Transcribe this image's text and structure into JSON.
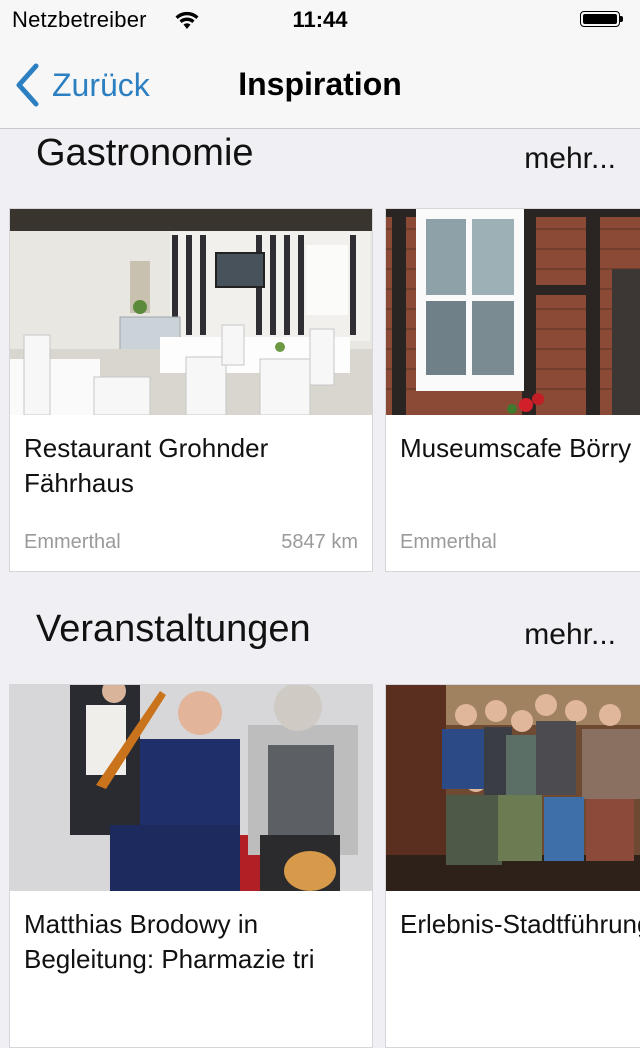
{
  "status_bar": {
    "carrier": "Netzbetreiber",
    "time": "11:44"
  },
  "nav": {
    "back_label": "Zurück",
    "title": "Inspiration"
  },
  "sections": [
    {
      "title": "Gastronomie",
      "more": "mehr...",
      "cards": [
        {
          "title": "Restaurant Grohnder Fährhaus",
          "location": "Emmerthal",
          "distance": "5847 km"
        },
        {
          "title": "Museumscafe Börry",
          "location": "Emmerthal",
          "distance": ""
        }
      ]
    },
    {
      "title": "Veranstaltungen",
      "more": "mehr...",
      "cards": [
        {
          "title": "Matthias Brodowy in Begleitung: Pharmazie tri",
          "location": "",
          "distance": ""
        },
        {
          "title": "Erlebnis-Stadtführung durch Rinteln",
          "location": "",
          "distance": ""
        }
      ]
    }
  ],
  "colors": {
    "accent": "#2c7fc1",
    "background": "#efeff4",
    "secondary_text": "#9a9a9a"
  }
}
